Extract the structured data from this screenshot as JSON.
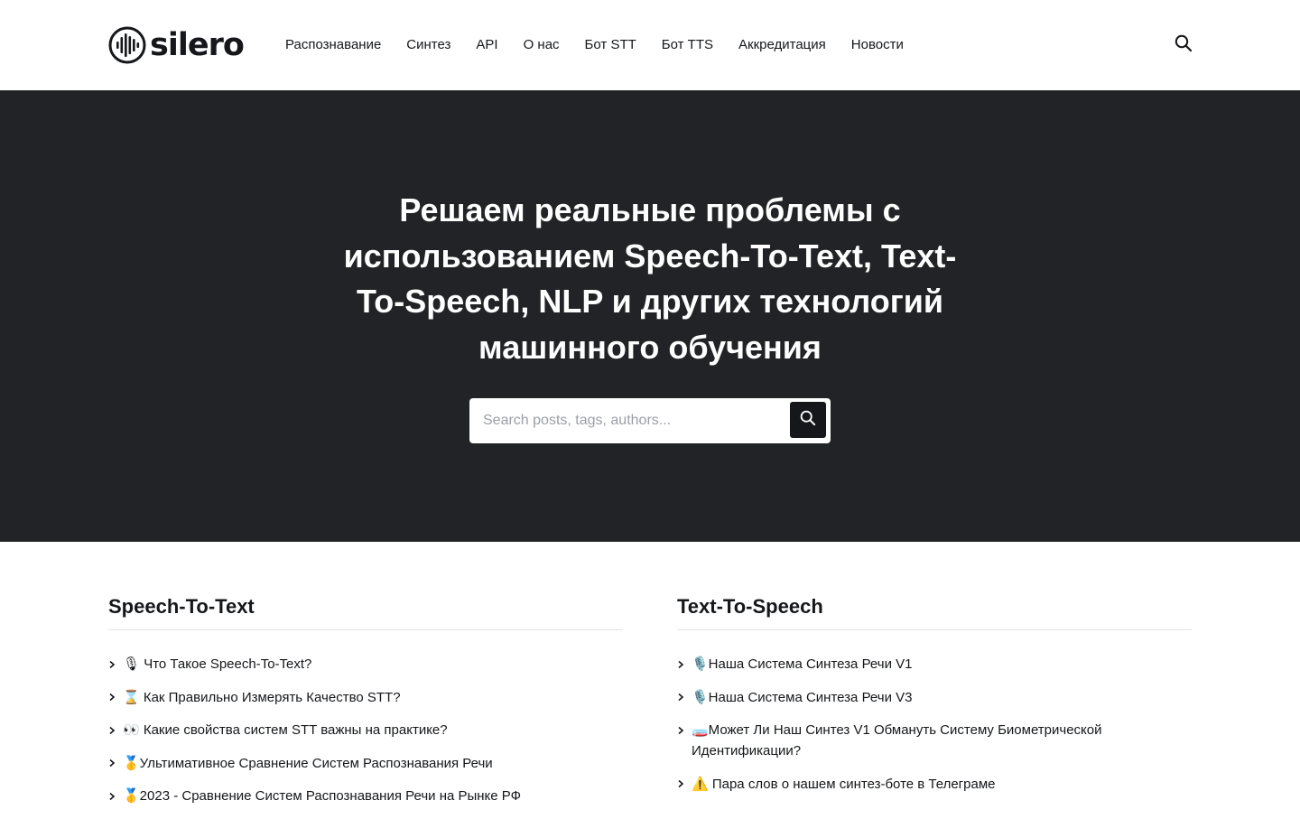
{
  "brand": {
    "logo_text": "silero",
    "logo_icon": "sound-wave-circle-icon"
  },
  "nav": {
    "items": [
      {
        "label": "Распознавание"
      },
      {
        "label": "Синтез"
      },
      {
        "label": "API"
      },
      {
        "label": "О нас"
      },
      {
        "label": "Бот STT"
      },
      {
        "label": "Бот TTS"
      },
      {
        "label": "Аккредитация"
      },
      {
        "label": "Новости"
      }
    ],
    "search_icon": "search-icon"
  },
  "hero": {
    "title": "Решаем реальные проблемы с использованием Speech-To-Text, Text-To-Speech, NLP и других технологий машинного обучения",
    "search_placeholder": "Search posts, tags, authors...",
    "search_button_icon": "search-icon",
    "background": "#222326"
  },
  "sections": {
    "stt": {
      "title": "Speech-To-Text",
      "posts": [
        {
          "label": "🎙 Что Такое Speech-To-Text?"
        },
        {
          "label": "⌛ Как Правильно Измерять Качество STT?"
        },
        {
          "label": "👀 Какие свойства систем STT важны на практике?"
        },
        {
          "label": "🥇Ультимативное Сравнение Систем Распознавания Речи"
        },
        {
          "label": "🥇2023 - Сравнение Систем Распознавания Речи на Рынке РФ"
        }
      ]
    },
    "tts": {
      "title": "Text-To-Speech",
      "posts": [
        {
          "label": "🎙️Наша Система Синтеза Речи V1"
        },
        {
          "label": "🎙️Наша Система Синтеза Речи V3"
        },
        {
          "label": "🧫Может Ли Наш Синтез V1 Обмануть Систему Биометрической Идентификации?"
        },
        {
          "label": "⚠️ Пара слов о нашем синтез-боте в Телеграме"
        }
      ]
    }
  },
  "colors": {
    "text": "#15171a",
    "hero_bg": "#222326",
    "divider": "#e3e4e7"
  }
}
